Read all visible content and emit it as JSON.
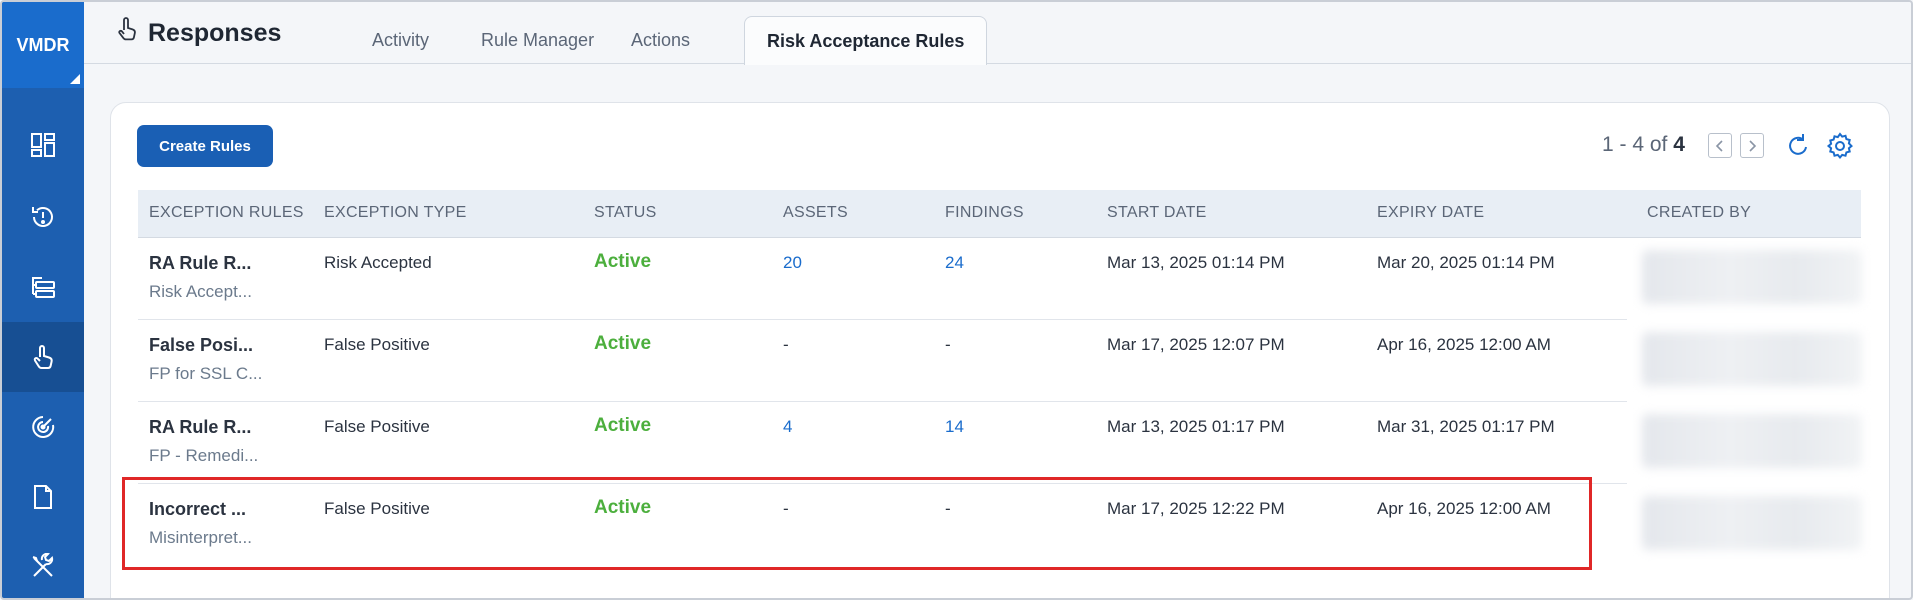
{
  "sidebar": {
    "brand": "VMDR",
    "items": [
      {
        "icon": "dashboard-icon"
      },
      {
        "icon": "alert-history-icon"
      },
      {
        "icon": "prioritization-list-icon"
      },
      {
        "icon": "hand-pointer-icon",
        "active": true
      },
      {
        "icon": "radar-scan-icon"
      },
      {
        "icon": "document-icon"
      },
      {
        "icon": "tools-icon"
      }
    ]
  },
  "header": {
    "title": "Responses",
    "tabs": [
      {
        "label": "Activity"
      },
      {
        "label": "Rule Manager"
      },
      {
        "label": "Actions"
      },
      {
        "label": "Risk Acceptance Rules",
        "active": true
      }
    ]
  },
  "toolbar": {
    "create_label": "Create Rules",
    "pager_range": "1 - 4 of ",
    "pager_total": "4"
  },
  "table": {
    "columns": [
      "EXCEPTION RULES",
      "EXCEPTION TYPE",
      "STATUS",
      "ASSETS",
      "FINDINGS",
      "START DATE",
      "EXPIRY DATE",
      "CREATED BY"
    ],
    "rows": [
      {
        "name": "RA Rule R...",
        "desc": "Risk Accept...",
        "type": "Risk Accepted",
        "status": "Active",
        "assets": "20",
        "findings": "24",
        "start": "Mar 13, 2025 01:14 PM",
        "expiry": "Mar 20, 2025 01:14 PM"
      },
      {
        "name": "False Posi...",
        "desc": "FP for SSL C...",
        "type": "False Positive",
        "status": "Active",
        "assets": "-",
        "findings": "-",
        "start": "Mar 17, 2025 12:07 PM",
        "expiry": "Apr 16, 2025 12:00 AM"
      },
      {
        "name": "RA Rule R...",
        "desc": "FP - Remedi...",
        "type": "False Positive",
        "status": "Active",
        "assets": "4",
        "findings": "14",
        "start": "Mar 13, 2025 01:17 PM",
        "expiry": "Mar 31, 2025 01:17 PM"
      },
      {
        "name": "Incorrect ...",
        "desc": "Misinterpret...",
        "type": "False Positive",
        "status": "Active",
        "assets": "-",
        "findings": "-",
        "start": "Mar 17, 2025 12:22 PM",
        "expiry": "Apr 16, 2025 12:00 AM"
      }
    ]
  },
  "colors": {
    "sidebar": "#1d5fb0",
    "accent": "#1a5fb4",
    "status_active": "#4caf3d",
    "highlight": "#e02727"
  }
}
